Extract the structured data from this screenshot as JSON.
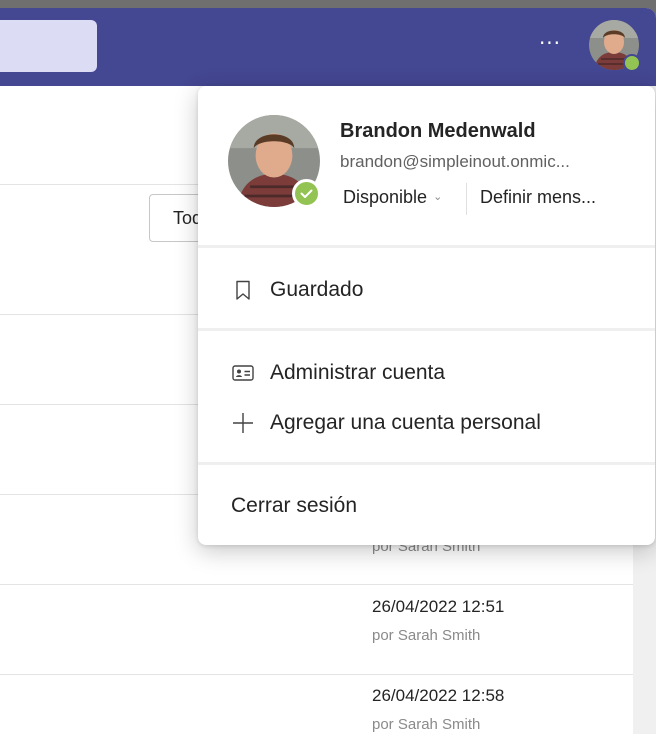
{
  "header": {
    "more_label": "···",
    "avatar_icon": "user-avatar-photo",
    "status_color": "#92c353",
    "bar_color": "#444791"
  },
  "content": {
    "filter_label": "Todos",
    "rows": [
      {
        "by": "por Sarah Smith"
      },
      {
        "date": "26/04/2022 12:51",
        "by": "por Sarah Smith"
      },
      {
        "date": "26/04/2022 12:58",
        "by": "por Sarah Smith"
      }
    ]
  },
  "profile_menu": {
    "name": "Brandon Medenwald",
    "email": "brandon@simpleinout.onmic...",
    "status_label": "Disponible",
    "set_message_label": "Definir mens...",
    "items": [
      {
        "label": "Guardado",
        "icon": "bookmark-icon"
      },
      {
        "label": "Administrar cuenta",
        "icon": "contact-card-icon"
      },
      {
        "label": "Agregar una cuenta personal",
        "icon": "add-icon"
      }
    ],
    "sign_out_label": "Cerrar sesión"
  }
}
